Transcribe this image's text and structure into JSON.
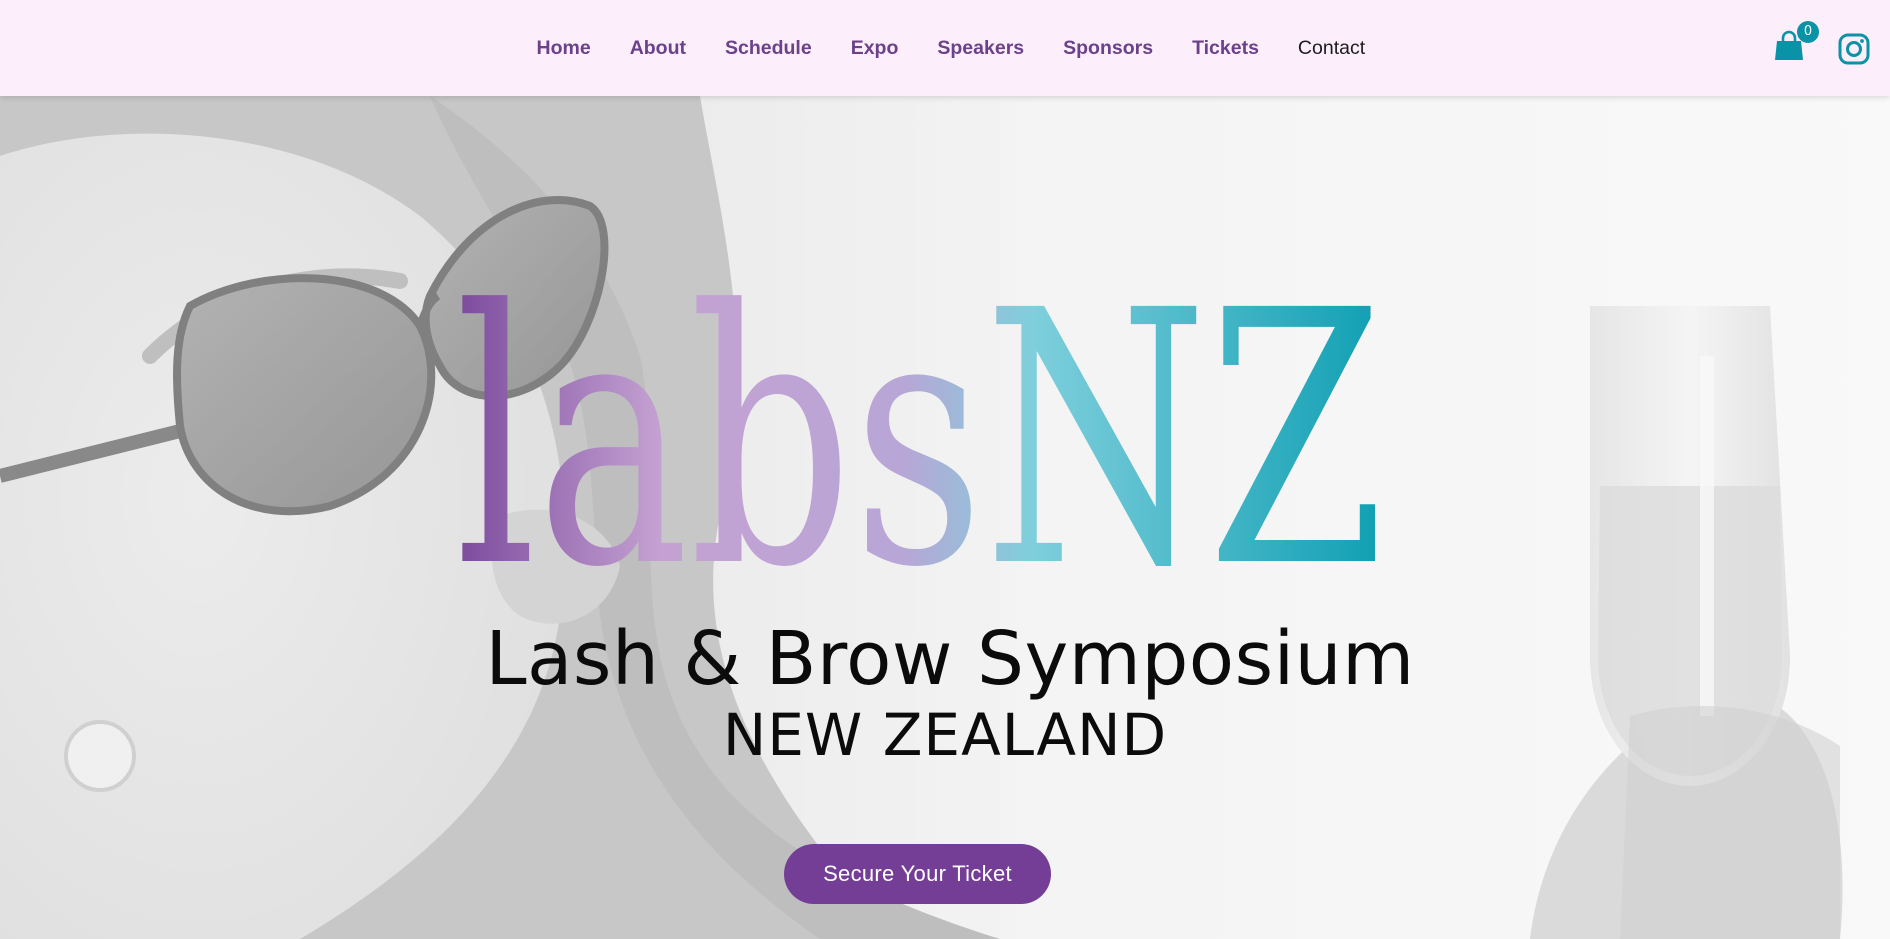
{
  "header": {
    "nav": [
      {
        "label": "Home",
        "name": "nav-item-home"
      },
      {
        "label": "About",
        "name": "nav-item-about"
      },
      {
        "label": "Schedule",
        "name": "nav-item-schedule"
      },
      {
        "label": "Expo",
        "name": "nav-item-expo"
      },
      {
        "label": "Speakers",
        "name": "nav-item-speakers"
      },
      {
        "label": "Sponsors",
        "name": "nav-item-sponsors"
      },
      {
        "label": "Tickets",
        "name": "nav-item-tickets"
      },
      {
        "label": "Contact",
        "name": "nav-item-contact"
      }
    ],
    "cart": {
      "count": "0",
      "icon": "shopping-bag-icon"
    },
    "social": {
      "icon": "instagram-icon"
    }
  },
  "hero": {
    "logo_text": "labsNZ",
    "tagline_line1": "Lash & Brow Symposium",
    "tagline_line2": "NEW ZEALAND",
    "cta_label": "Secure Your Ticket"
  },
  "colors": {
    "header_bg": "#fdeefc",
    "nav_text": "#6b4189",
    "cta_bg": "#743e97",
    "accent_teal": "#0a93a6",
    "logo_purple": "#7b4a9c",
    "logo_lilac": "#c4a1d2",
    "logo_cyan": "#6fd0dc"
  }
}
